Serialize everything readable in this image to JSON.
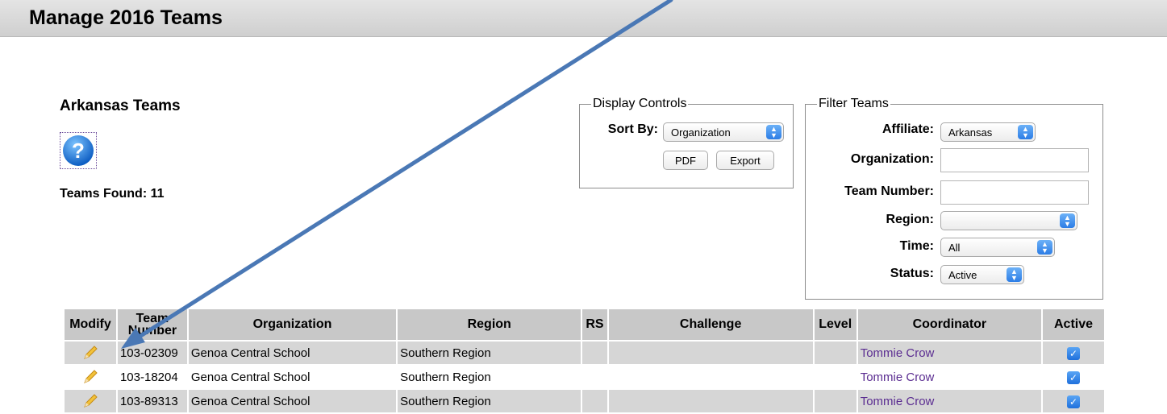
{
  "page": {
    "title": "Manage 2016 Teams",
    "affiliate_heading": "Arkansas Teams",
    "teams_found": "Teams Found: 11"
  },
  "display_controls": {
    "legend": "Display Controls",
    "sort_by_label": "Sort By:",
    "sort_by_value": "Organization",
    "pdf_label": "PDF",
    "export_label": "Export"
  },
  "filter_teams": {
    "legend": "Filter Teams",
    "affiliate_label": "Affiliate:",
    "affiliate_value": "Arkansas",
    "organization_label": "Organization:",
    "organization_value": "",
    "team_number_label": "Team Number:",
    "team_number_value": "",
    "region_label": "Region:",
    "region_value": "",
    "time_label": "Time:",
    "time_value": "All",
    "status_label": "Status:",
    "status_value": "Active"
  },
  "table": {
    "headers": {
      "modify": "Modify",
      "team_number": "Team Number",
      "organization": "Organization",
      "region": "Region",
      "rs": "RS",
      "challenge": "Challenge",
      "level": "Level",
      "coordinator": "Coordinator",
      "active": "Active"
    },
    "rows": [
      {
        "team_number": "103-02309",
        "organization": "Genoa Central School",
        "region": "Southern Region",
        "rs": "",
        "challenge": "",
        "level": "",
        "coordinator": "Tommie Crow",
        "active": true
      },
      {
        "team_number": "103-18204",
        "organization": "Genoa Central School",
        "region": "Southern Region",
        "rs": "",
        "challenge": "",
        "level": "",
        "coordinator": "Tommie Crow",
        "active": true
      },
      {
        "team_number": "103-89313",
        "organization": "Genoa Central School",
        "region": "Southern Region",
        "rs": "",
        "challenge": "",
        "level": "",
        "coordinator": "Tommie Crow",
        "active": true
      }
    ]
  },
  "colors": {
    "accent_blue": "#2c7de6",
    "annotation_arrow": "#4a78b5",
    "link_purple": "#5b2d91",
    "header_gray": "#c8c8c8"
  },
  "icons": {
    "help": "question-mark-circle-icon",
    "modify": "pencil-icon",
    "active": "checkbox-checked-icon",
    "annotation": "callout-arrow"
  }
}
